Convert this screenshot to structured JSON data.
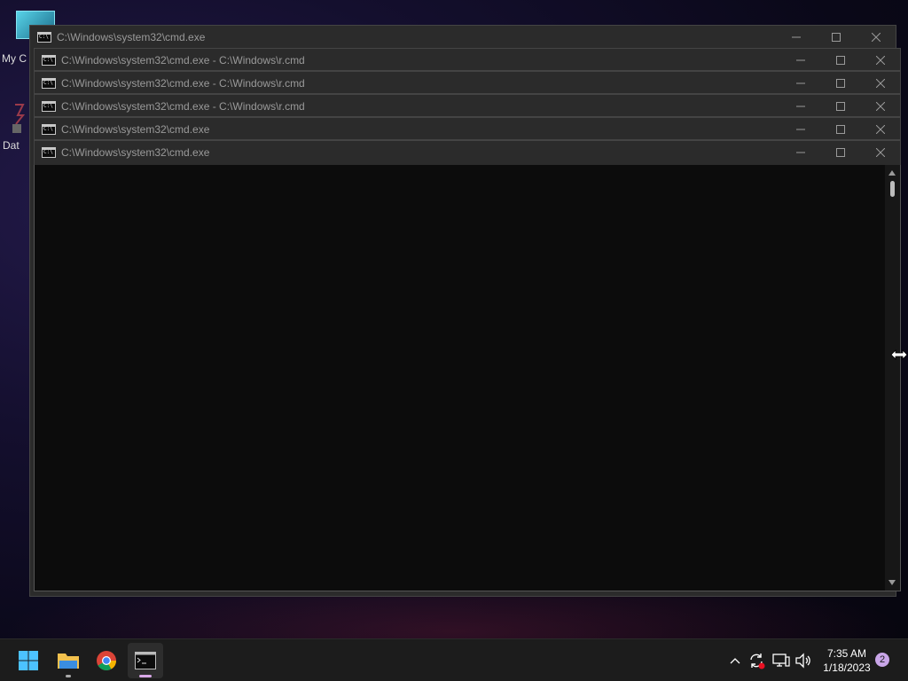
{
  "desktop": {
    "labels": {
      "my_computer": "My C",
      "second": "Dat"
    }
  },
  "windows": [
    {
      "title": "C:\\Windows\\system32\\cmd.exe"
    },
    {
      "title": "C:\\Windows\\system32\\cmd.exe - C:\\Windows\\r.cmd"
    },
    {
      "title": "C:\\Windows\\system32\\cmd.exe - C:\\Windows\\r.cmd"
    },
    {
      "title": "C:\\Windows\\system32\\cmd.exe - C:\\Windows\\r.cmd"
    },
    {
      "title": "C:\\Windows\\system32\\cmd.exe"
    },
    {
      "title": "C:\\Windows\\system32\\cmd.exe"
    }
  ],
  "taskbar": {
    "apps": [
      {
        "icon": "windows-start-icon"
      },
      {
        "icon": "file-explorer-icon"
      },
      {
        "icon": "chrome-icon"
      },
      {
        "icon": "command-prompt-icon"
      }
    ],
    "clock": {
      "time": "7:35 AM",
      "date": "1/18/2023"
    },
    "notification_count": "2"
  },
  "colors": {
    "accent": "#c9a6e8",
    "console_bg": "#0c0c0c",
    "titlebar_bg": "#2b2b2b"
  }
}
